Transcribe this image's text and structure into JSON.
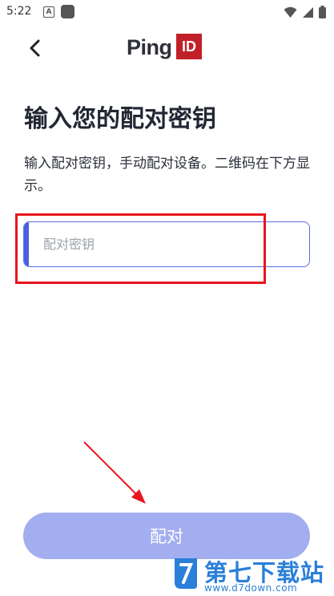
{
  "status_bar": {
    "time": "5:22",
    "badge": "A"
  },
  "header": {
    "logo_text": "Ping",
    "logo_badge": "ID"
  },
  "main": {
    "title": "输入您的配对密钥",
    "description": "输入配对密钥，手动配对设备。二维码在下方显示。",
    "input": {
      "placeholder": "配对密钥",
      "value": ""
    },
    "submit_label": "配对"
  },
  "watermark": {
    "name": "第七下载站",
    "url": "www.d7down.com"
  },
  "colors": {
    "accent": "#4a5ee0",
    "button": "#a3aef0",
    "logo_red": "#c22028",
    "annotation": "#e8141e",
    "watermark": "#2a7fd8"
  },
  "icons": [
    "back-arrow-icon",
    "wifi-icon",
    "signal-icon",
    "battery-icon"
  ]
}
